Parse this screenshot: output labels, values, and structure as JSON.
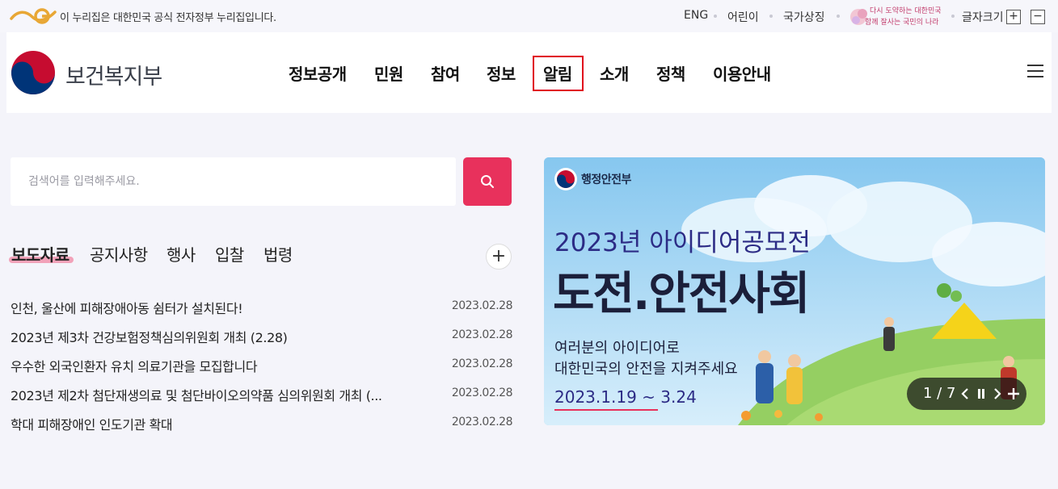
{
  "gov_bar": {
    "notice": "이 누리집은 대한민국 공식 전자정부 누리집입니다.",
    "links": [
      "ENG",
      "어린이",
      "국가상징"
    ],
    "slogan_line1": "다시 도약하는 대한민국",
    "slogan_line2": "함께 잘사는 국민의 나라",
    "font_size_label": "글자크기",
    "font_plus": "+",
    "font_minus": "−"
  },
  "header": {
    "ministry_name": "보건복지부",
    "nav": [
      "정보공개",
      "민원",
      "참여",
      "정보",
      "알림",
      "소개",
      "정책",
      "이용안내"
    ],
    "highlighted_nav": "알림"
  },
  "search": {
    "placeholder": "검색어를 입력해주세요."
  },
  "news": {
    "tabs": [
      "보도자료",
      "공지사항",
      "행사",
      "입찰",
      "법령"
    ],
    "active_tab": "보도자료",
    "more_label": "+",
    "items": [
      {
        "title": "인천, 울산에 피해장애아동 쉼터가 설치된다!",
        "date": "2023.02.28"
      },
      {
        "title": "2023년 제3차 건강보험정책심의위원회 개최 (2.28)",
        "date": "2023.02.28"
      },
      {
        "title": "우수한 외국인환자 유치 의료기관을 모집합니다",
        "date": "2023.02.28"
      },
      {
        "title": "2023년 제2차 첨단재생의료 및 첨단바이오의약품 심의위원회 개최 (...",
        "date": "2023.02.28"
      },
      {
        "title": "학대 피해장애인 인도기관 확대",
        "date": "2023.02.28"
      }
    ]
  },
  "banner": {
    "org": "행정안전부",
    "subtitle": "2023년 아이디어공모전",
    "title": "도전.안전사회",
    "desc1": "여러분의 아이디어로",
    "desc2": "대한민국의 안전을 지켜주세요",
    "period": "2023.1.19 ~ 3.24",
    "slide_count": "1 / 7"
  },
  "colors": {
    "accent": "#e8315c",
    "highlight_border": "#e0001b",
    "page_bg": "#f4f4fa"
  }
}
